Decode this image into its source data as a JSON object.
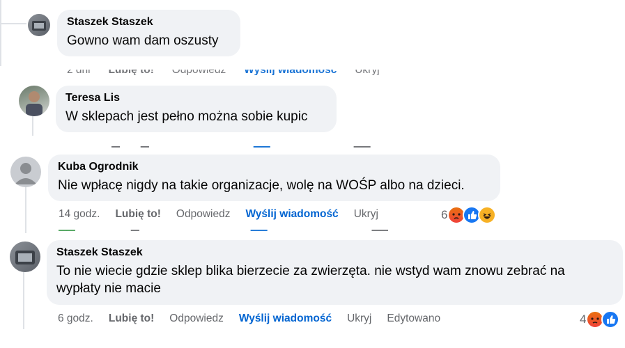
{
  "comments": [
    {
      "name": "Staszek Staszek",
      "text": "Gowno wam dam oszusty",
      "actions_faded": [
        "2 dni",
        "Lubię to!",
        "Odpowiedz",
        "Wyślij wiadomość",
        "Ukryj"
      ]
    },
    {
      "name": "Teresa Lis",
      "text": "W sklepach jest pełno można sobie kupic"
    },
    {
      "name": "Kuba Ogrodnik",
      "text": "Nie wpłacę nigdy na takie organizacje, wolę na WOŚP albo na dzieci.",
      "time": "14 godz.",
      "like": "Lubię to!",
      "reply": "Odpowiedz",
      "message": "Wyślij wiadomość",
      "hide": "Ukryj",
      "reaction_count": "6"
    },
    {
      "name": "Staszek Staszek",
      "text_line1": "To nie wiecie gdzie sklep blika bierzecie za zwierzęta. nie wstyd wam znowu zebrać na",
      "text_line2": "wypłaty nie macie",
      "time": "6 godz.",
      "like": "Lubię to!",
      "reply": "Odpowiedz",
      "message": "Wyślij wiadomość",
      "hide": "Ukryj",
      "edited": "Edytowano",
      "reaction_count": "4"
    }
  ],
  "colors": {
    "bubble": "#f0f2f5",
    "link": "#0064d1",
    "muted": "#65676b",
    "like": "#1877f2"
  }
}
